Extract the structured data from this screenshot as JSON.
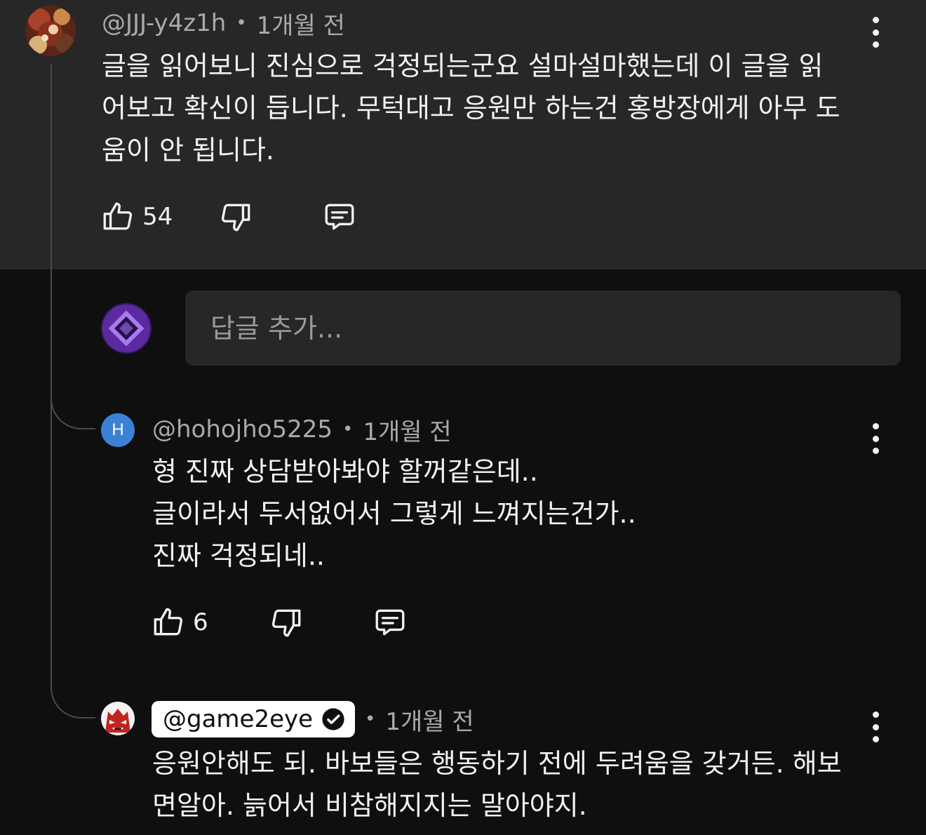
{
  "comment": {
    "author": "@JJJ-y4z1h",
    "separator": "•",
    "time": "1개월 전",
    "lines": [
      "글을 읽어보니 진심으로 걱정되는군요 설마설마했는데 이 글을 읽",
      "어보고 확신이 듭니다. 무턱대고 응원만 하는건 홍방장에게 아무 도",
      "움이 안 됩니다."
    ],
    "likes": "54",
    "avatar_icon": "painted-portrait-avatar"
  },
  "reply_input": {
    "placeholder": "답글 추가...",
    "avatar_icon": "purple-diamond-avatar"
  },
  "replies": [
    {
      "author": "@hohojho5225",
      "separator": "•",
      "time": "1개월 전",
      "avatar_letter": "H",
      "avatar_color": "#3b82d6",
      "lines": [
        "형 진짜 상담받아봐야 할꺼같은데..",
        "글이라서 두서없어서 그렇게 느껴지는건가..",
        "진짜 걱정되네.."
      ],
      "likes": "6"
    },
    {
      "author": "@game2eye",
      "verified_icon": "verified-check-icon",
      "separator": "•",
      "time": "1개월 전",
      "avatar_icon": "red-demon-avatar",
      "lines": [
        "응원안해도 되. 바보들은 행동하기 전에 두려움을 갖거든. 해보",
        "면알아. 늙어서 비참해지지는 말아야지."
      ]
    }
  ],
  "colors": {
    "background": "#0f0f0f",
    "panel": "#272727",
    "text": "#f1f1f1",
    "muted": "#aaaaaa"
  }
}
